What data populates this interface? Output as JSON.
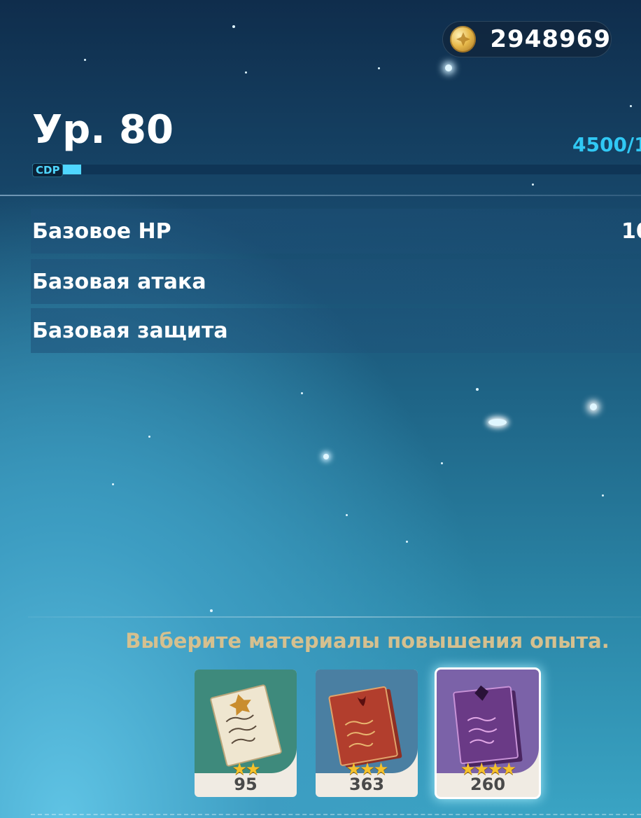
{
  "currency": {
    "mora_icon": "mora-coin-icon",
    "amount": "2948969"
  },
  "level": {
    "title": "Ур. 80",
    "exp_text": "4500/1",
    "exp_progress": 0.008,
    "exp_tag": "CDP"
  },
  "stats": [
    {
      "label": "Базовое HP",
      "value": "10"
    },
    {
      "label": "Базовая атака",
      "value": ""
    },
    {
      "label": "Базовая защита",
      "value": ""
    }
  ],
  "hint": "Выберите материалы повышения опыта.",
  "materials": [
    {
      "name": "wanderers-advice",
      "rarity": 2,
      "stars": "★★",
      "count": "95",
      "bg": "#3e8a7c",
      "selected": false
    },
    {
      "name": "adventurers-experience",
      "rarity": 3,
      "stars": "★★★",
      "count": "363",
      "bg": "#4a7fa2",
      "selected": false
    },
    {
      "name": "heros-wit",
      "rarity": 4,
      "stars": "★★★★",
      "count": "260",
      "bg": "#7b62a8",
      "selected": true
    }
  ]
}
